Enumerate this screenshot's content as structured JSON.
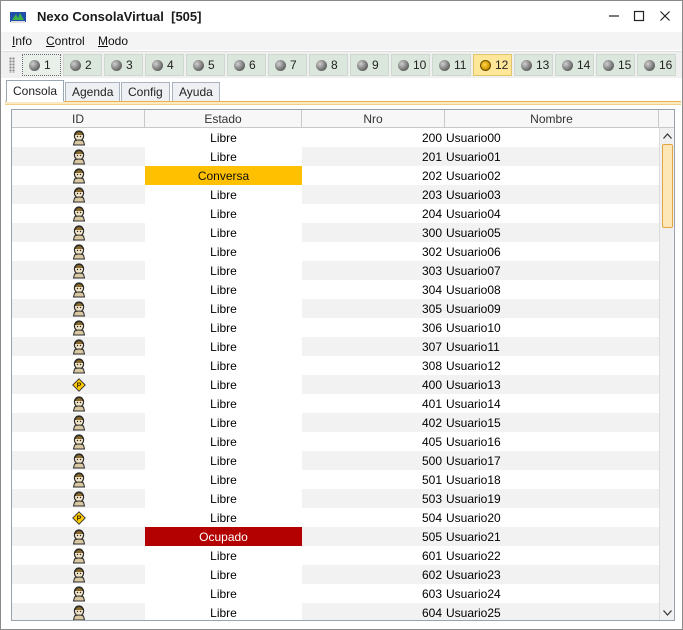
{
  "window": {
    "title": "Nexo ConsolaVirtual  [505]"
  },
  "menu": [
    {
      "accel": "I",
      "rest": "nfo"
    },
    {
      "accel": "C",
      "rest": "ontrol"
    },
    {
      "accel": "M",
      "rest": "odo"
    }
  ],
  "lines": [
    {
      "label": "1",
      "state": "idle",
      "selected": true
    },
    {
      "label": "2",
      "state": "idle"
    },
    {
      "label": "3",
      "state": "idle"
    },
    {
      "label": "4",
      "state": "idle"
    },
    {
      "label": "5",
      "state": "idle"
    },
    {
      "label": "6",
      "state": "idle"
    },
    {
      "label": "7",
      "state": "idle"
    },
    {
      "label": "8",
      "state": "idle"
    },
    {
      "label": "9",
      "state": "idle"
    },
    {
      "label": "10",
      "state": "idle"
    },
    {
      "label": "11",
      "state": "idle"
    },
    {
      "label": "12",
      "state": "alert",
      "active": true
    },
    {
      "label": "13",
      "state": "idle"
    },
    {
      "label": "14",
      "state": "idle"
    },
    {
      "label": "15",
      "state": "idle"
    },
    {
      "label": "16",
      "state": "idle"
    }
  ],
  "tabs": [
    {
      "label": "Consola",
      "active": true
    },
    {
      "label": "Agenda"
    },
    {
      "label": "Config"
    },
    {
      "label": "Ayuda"
    }
  ],
  "table": {
    "columns": [
      "ID",
      "Estado",
      "Nro",
      "Nombre"
    ],
    "rows": [
      {
        "icon": "user-icon",
        "estado": "Libre",
        "nro": "200",
        "nombre": "Usuario00"
      },
      {
        "icon": "user-icon",
        "estado": "Libre",
        "nro": "201",
        "nombre": "Usuario01"
      },
      {
        "icon": "user-icon",
        "estado": "Conversa",
        "nro": "202",
        "nombre": "Usuario02"
      },
      {
        "icon": "user-icon",
        "estado": "Libre",
        "nro": "203",
        "nombre": "Usuario03"
      },
      {
        "icon": "user-icon",
        "estado": "Libre",
        "nro": "204",
        "nombre": "Usuario04"
      },
      {
        "icon": "user-icon",
        "estado": "Libre",
        "nro": "300",
        "nombre": "Usuario05"
      },
      {
        "icon": "user-icon",
        "estado": "Libre",
        "nro": "302",
        "nombre": "Usuario06"
      },
      {
        "icon": "user-icon",
        "estado": "Libre",
        "nro": "303",
        "nombre": "Usuario07"
      },
      {
        "icon": "user-icon",
        "estado": "Libre",
        "nro": "304",
        "nombre": "Usuario08"
      },
      {
        "icon": "user-icon",
        "estado": "Libre",
        "nro": "305",
        "nombre": "Usuario09"
      },
      {
        "icon": "user-icon",
        "estado": "Libre",
        "nro": "306",
        "nombre": "Usuario10"
      },
      {
        "icon": "user-icon",
        "estado": "Libre",
        "nro": "307",
        "nombre": "Usuario11"
      },
      {
        "icon": "user-icon",
        "estado": "Libre",
        "nro": "308",
        "nombre": "Usuario12"
      },
      {
        "icon": "diamond-icon",
        "estado": "Libre",
        "nro": "400",
        "nombre": "Usuario13"
      },
      {
        "icon": "user-icon",
        "estado": "Libre",
        "nro": "401",
        "nombre": "Usuario14"
      },
      {
        "icon": "user-icon",
        "estado": "Libre",
        "nro": "402",
        "nombre": "Usuario15"
      },
      {
        "icon": "user-icon",
        "estado": "Libre",
        "nro": "405",
        "nombre": "Usuario16"
      },
      {
        "icon": "user-icon",
        "estado": "Libre",
        "nro": "500",
        "nombre": "Usuario17"
      },
      {
        "icon": "user-icon",
        "estado": "Libre",
        "nro": "501",
        "nombre": "Usuario18"
      },
      {
        "icon": "user-icon",
        "estado": "Libre",
        "nro": "503",
        "nombre": "Usuario19"
      },
      {
        "icon": "diamond-icon",
        "estado": "Libre",
        "nro": "504",
        "nombre": "Usuario20"
      },
      {
        "icon": "user-icon",
        "estado": "Ocupado",
        "nro": "505",
        "nombre": "Usuario21"
      },
      {
        "icon": "user-icon",
        "estado": "Libre",
        "nro": "601",
        "nombre": "Usuario22"
      },
      {
        "icon": "user-icon",
        "estado": "Libre",
        "nro": "602",
        "nombre": "Usuario23"
      },
      {
        "icon": "user-icon",
        "estado": "Libre",
        "nro": "603",
        "nombre": "Usuario24"
      },
      {
        "icon": "user-icon",
        "estado": "Libre",
        "nro": "604",
        "nombre": "Usuario25"
      }
    ]
  },
  "colors": {
    "conversa": "#ffc000",
    "ocupado": "#b30000",
    "accent": "#e7b24c"
  }
}
